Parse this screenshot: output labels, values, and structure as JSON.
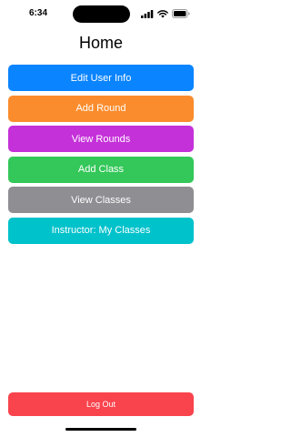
{
  "status_bar": {
    "time": "6:34",
    "icons": [
      "signal-icon",
      "wifi-icon",
      "battery-icon"
    ]
  },
  "header": {
    "title": "Home"
  },
  "menu": {
    "buttons": [
      {
        "label": "Edit User Info",
        "color": "#0a84ff"
      },
      {
        "label": "Add Round",
        "color": "#fb8c2d"
      },
      {
        "label": "View Rounds",
        "color": "#c531d9"
      },
      {
        "label": "Add Class",
        "color": "#34c759"
      },
      {
        "label": "View Classes",
        "color": "#8e8e93"
      },
      {
        "label": "Instructor: My Classes",
        "color": "#00c2cb"
      }
    ]
  },
  "footer": {
    "logout_label": "Log Out",
    "logout_color": "#f9444d"
  }
}
